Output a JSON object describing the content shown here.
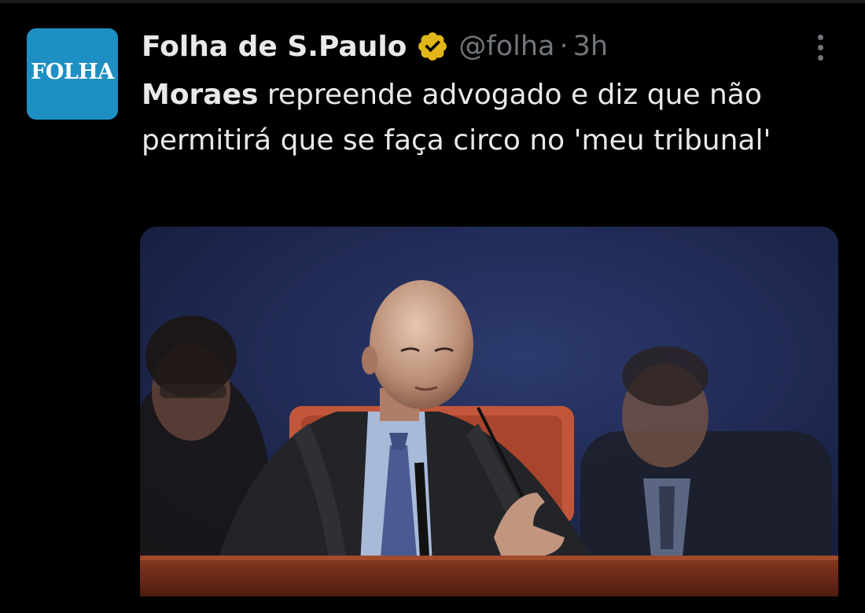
{
  "tweet": {
    "avatar_label": "FOLHA",
    "display_name": "Folha de S.Paulo",
    "handle": "@folha",
    "separator": "·",
    "time": "3h",
    "text_bold": "Moraes",
    "text_rest": " repreende advogado e diz que não permitirá que se faça circo no 'meu tribunal'",
    "media_icon": "photo",
    "verified_icon": "verified-badge-icon",
    "more_icon": "more-vertical-icon"
  },
  "colors": {
    "background": "#000000",
    "text_primary": "#e7e9ea",
    "text_secondary": "#71767b",
    "verified_gold": "#e2b719",
    "avatar_blue": "#1e8fc2"
  }
}
